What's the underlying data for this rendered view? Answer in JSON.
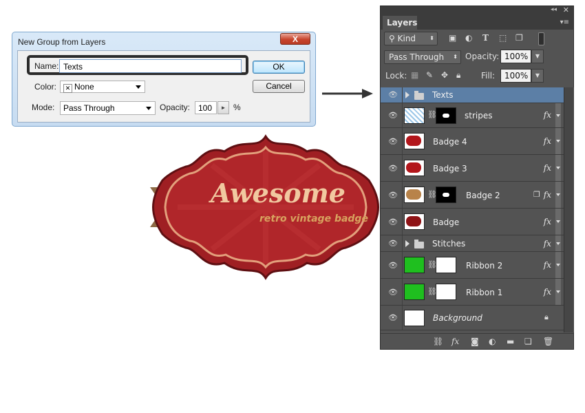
{
  "dialog": {
    "title": "New Group from Layers",
    "close_label": "X",
    "name_label": "Name:",
    "name_value": "Texts",
    "color_label": "Color:",
    "color_value": "None",
    "mode_label": "Mode:",
    "mode_value": "Pass Through",
    "opacity_label": "Opacity:",
    "opacity_value": "100",
    "opacity_unit": "%",
    "ok_label": "OK",
    "cancel_label": "Cancel"
  },
  "artwork": {
    "title": "Awesome",
    "subtitle": "retro vintage badge",
    "colors": {
      "badge_red": "#9f1f23",
      "badge_border": "#d89a78",
      "ribbon": "#8c6a45",
      "title_text": "#f1c9a0",
      "subtitle_text": "#d8a35f"
    }
  },
  "layers_panel": {
    "tab_label": "Layers",
    "filter_kind": "Kind",
    "blend_mode": "Pass Through",
    "opacity_label": "Opacity:",
    "opacity_value": "100%",
    "lock_label": "Lock:",
    "fill_label": "Fill:",
    "fill_value": "100%",
    "fx_label": "fx",
    "layers": [
      {
        "name": "Texts",
        "type": "group",
        "selected": true
      },
      {
        "name": "stripes",
        "type": "layer-with-mask",
        "fx": true
      },
      {
        "name": "Badge 4",
        "type": "layer",
        "fx": true
      },
      {
        "name": "Badge 3",
        "type": "layer",
        "fx": true
      },
      {
        "name": "Badge 2",
        "type": "layer-with-mask",
        "fx": true
      },
      {
        "name": "Badge",
        "type": "layer",
        "fx": true
      },
      {
        "name": "Stitches",
        "type": "group",
        "fx": true
      },
      {
        "name": "Ribbon 2",
        "type": "layer-with-mask",
        "fx": true
      },
      {
        "name": "Ribbon 1",
        "type": "layer-with-mask",
        "fx": true
      },
      {
        "name": "Background",
        "type": "background",
        "locked": true
      }
    ],
    "colors": {
      "panel_bg": "#535353",
      "selected_row": "#5c7fa6",
      "thumb_green": "#1fbf1f",
      "thumb_red": "#b3161b",
      "thumb_tan": "#b8834a"
    }
  }
}
